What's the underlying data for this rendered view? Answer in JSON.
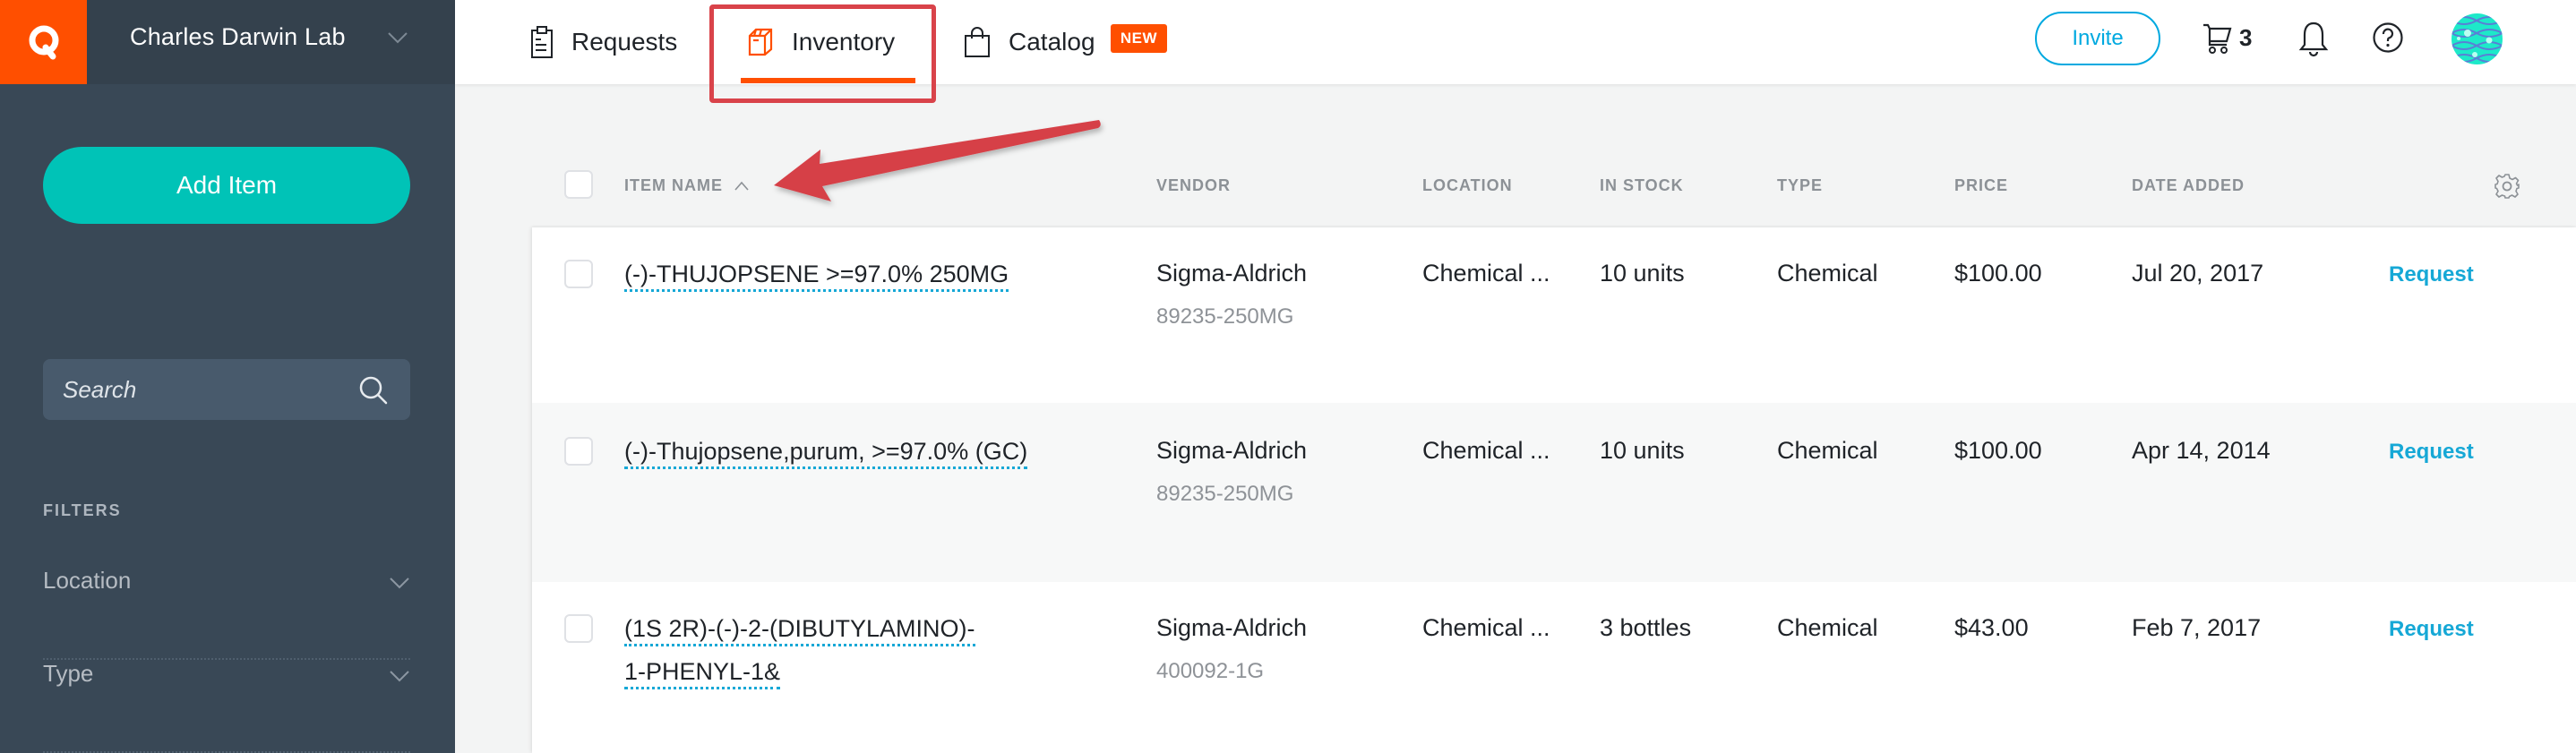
{
  "sidebar": {
    "lab_name": "Charles Darwin Lab",
    "add_item_label": "Add Item",
    "search_placeholder": "Search",
    "filters_label": "FILTERS",
    "filters": [
      {
        "label": "Location"
      },
      {
        "label": "Type"
      }
    ]
  },
  "nav": {
    "tabs": [
      {
        "label": "Requests",
        "icon": "clipboard-icon"
      },
      {
        "label": "Inventory",
        "icon": "box-icon",
        "active": true
      },
      {
        "label": "Catalog",
        "icon": "shopping-bag-icon",
        "badge": "NEW"
      }
    ],
    "invite_label": "Invite",
    "cart_count": "3"
  },
  "colors": {
    "brand_orange": "#ff4f00",
    "teal_button": "#00c3b7",
    "link_blue": "#16a8d6",
    "sidebar_bg": "#394856",
    "annotation_red": "#d9434a"
  },
  "table": {
    "headers": {
      "item_name": "ITEM NAME",
      "vendor": "VENDOR",
      "location": "LOCATION",
      "in_stock": "IN STOCK",
      "type": "TYPE",
      "price": "PRICE",
      "date_added": "DATE ADDED"
    },
    "sort": {
      "column": "item_name",
      "direction": "ascending"
    },
    "rows": [
      {
        "item_name": "(-)-THUJOPSENE >=97.0% 250MG",
        "vendor": "Sigma-Aldrich",
        "catalog_number": "89235-250MG",
        "location": "Chemical ...",
        "in_stock": "10 units",
        "type": "Chemical",
        "price": "$100.00",
        "date_added": "Jul 20, 2017",
        "action": "Request"
      },
      {
        "item_name": "(-)-Thujopsene,purum, >=97.0% (GC)",
        "vendor": "Sigma-Aldrich",
        "catalog_number": "89235-250MG",
        "location": "Chemical ...",
        "in_stock": "10 units",
        "type": "Chemical",
        "price": "$100.00",
        "date_added": "Apr 14, 2014",
        "action": "Request"
      },
      {
        "item_name_line1": "(1S 2R)-(-)-2-(DIBUTYLAMINO)-",
        "item_name_line2": "1-PHENYL-1&",
        "vendor": "Sigma-Aldrich",
        "catalog_number": "400092-1G",
        "location": "Chemical ...",
        "in_stock": "3 bottles",
        "type": "Chemical",
        "price": "$43.00",
        "date_added": "Feb 7, 2017",
        "action": "Request"
      }
    ]
  }
}
